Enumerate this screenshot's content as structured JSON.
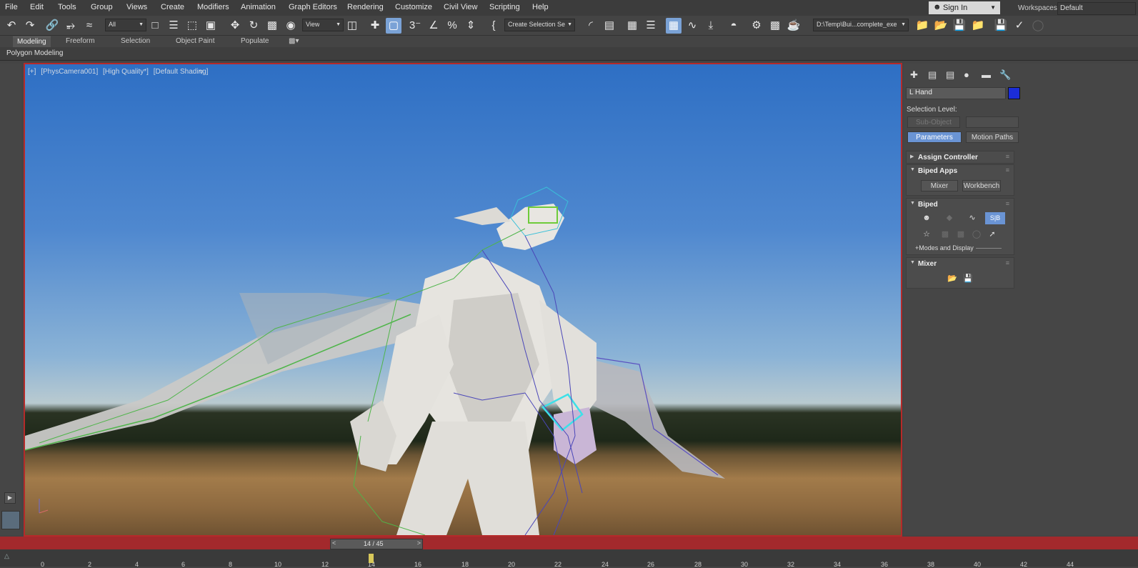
{
  "menu": [
    "File",
    "Edit",
    "Tools",
    "Group",
    "Views",
    "Create",
    "Modifiers",
    "Animation",
    "Graph Editors",
    "Rendering",
    "Customize",
    "Civil View",
    "Scripting",
    "Help"
  ],
  "signin": {
    "label": "Sign In"
  },
  "workspaces": {
    "label": "Workspaces:",
    "value": "Default"
  },
  "toolbar": {
    "selection_filter": "All",
    "ref_coord": "View",
    "named_selection": "Create Selection Se",
    "path": "D:\\Temp\\Bui...complete_exe"
  },
  "ribbon": {
    "tabs": [
      "Modeling",
      "Freeform",
      "Selection",
      "Object Paint",
      "Populate"
    ],
    "active_tab": "Modeling",
    "sub_label": "Polygon Modeling"
  },
  "viewport": {
    "labels": [
      "[+]",
      "[PhysCamera001]",
      "[High Quality*]",
      "[Default Shading]"
    ]
  },
  "command_panel": {
    "object_name": "L Hand",
    "object_color": "#1b2dd8",
    "selection_level_label": "Selection Level:",
    "sub_object": "Sub-Object",
    "tab_parameters": "Parameters",
    "tab_motion_paths": "Motion Paths",
    "rollouts": {
      "assign_controller": "Assign Controller",
      "biped_apps": "Biped Apps",
      "mixer_btn": "Mixer",
      "workbench_btn": "Workbench",
      "biped": "Biped",
      "modes_display": "+Modes and Display",
      "mixer": "Mixer"
    }
  },
  "timeline": {
    "current": "14 / 45",
    "ticks": [
      "0",
      "2",
      "4",
      "6",
      "8",
      "10",
      "12",
      "14",
      "16",
      "18",
      "20",
      "22",
      "24",
      "26",
      "28",
      "30",
      "32",
      "34",
      "36",
      "38",
      "40",
      "42",
      "44"
    ]
  }
}
